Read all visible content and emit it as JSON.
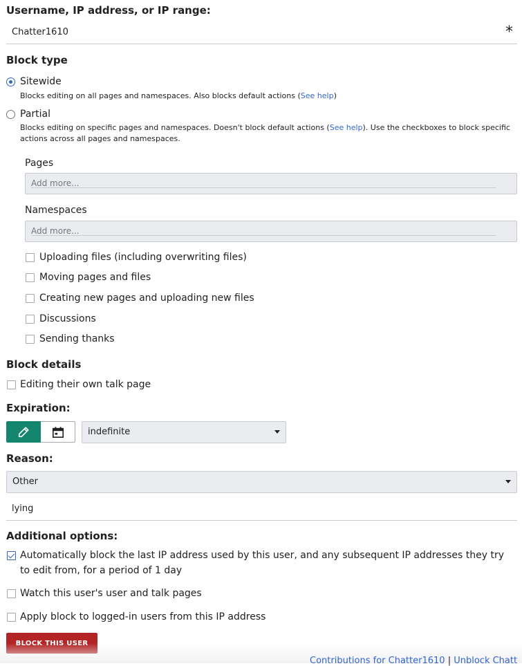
{
  "target": {
    "label": "Username, IP address, or IP range:",
    "value": "Chatter1610",
    "required_mark": "*"
  },
  "block_type": {
    "heading": "Block type",
    "sitewide": {
      "label": "Sitewide",
      "help_prefix": "Blocks editing on all pages and namespaces. Also blocks default actions (",
      "help_link": "See help",
      "help_suffix": ")"
    },
    "partial": {
      "label": "Partial",
      "help_prefix": "Blocks editing on specific pages and namespaces. Doesn't block default actions (",
      "help_link": "See help",
      "help_suffix": "). Use the checkboxes to block specific actions across all pages and namespaces."
    },
    "pages_label": "Pages",
    "pages_placeholder": "Add more...",
    "namespaces_label": "Namespaces",
    "namespaces_placeholder": "Add more...",
    "actions": [
      "Uploading files (including overwriting files)",
      "Moving pages and files",
      "Creating new pages and uploading new files",
      "Discussions",
      "Sending thanks"
    ]
  },
  "block_details": {
    "heading": "Block details",
    "own_talk_label": "Editing their own talk page"
  },
  "expiration": {
    "heading": "Expiration:",
    "value": "indefinite"
  },
  "reason": {
    "heading": "Reason:",
    "select_value": "Other",
    "other_text": "lying"
  },
  "additional": {
    "heading": "Additional options:",
    "autoblock_label": "Automatically block the last IP address used by this user, and any subsequent IP addresses they try to edit from, for a period of 1 day",
    "watch_label": "Watch this user's user and talk pages",
    "hardblock_label": "Apply block to logged-in users from this IP address"
  },
  "submit_label": "BLOCK THIS USER",
  "footer": {
    "contribs_link": "Contributions for Chatter1610",
    "separator": "|",
    "unblock_link": "Unblock Chatt"
  },
  "colors": {
    "accent": "#3366cc",
    "active_toggle": "#14866d",
    "destructive": "#b32424"
  }
}
